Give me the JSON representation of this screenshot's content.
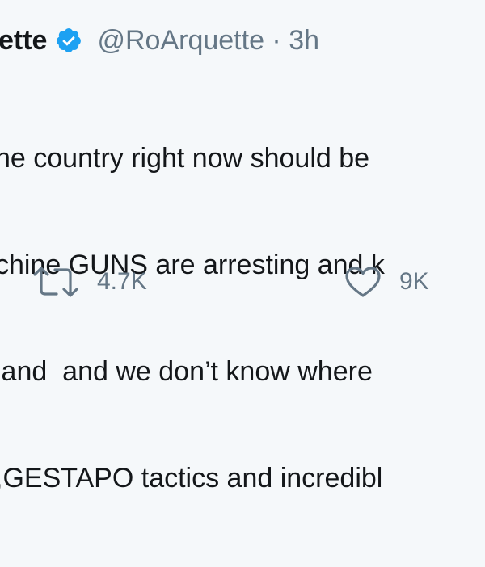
{
  "tweet": {
    "author_name": "ette",
    "author_handle": "@RoArquette",
    "separator": " · ",
    "time": "3h",
    "lines": [
      "he country right now should be",
      "chine GUNS are arresting and k",
      "land  and we don’t know where",
      ",GESTAPO tactics and incredibl"
    ],
    "retweet_count": "4.7K",
    "like_count": "9K"
  },
  "colors": {
    "background": "#f5f8fa",
    "text": "#14171a",
    "secondary": "#657786",
    "verified": "#1da1f2"
  },
  "icons": [
    "verified-badge-icon",
    "retweet-icon",
    "heart-icon"
  ]
}
